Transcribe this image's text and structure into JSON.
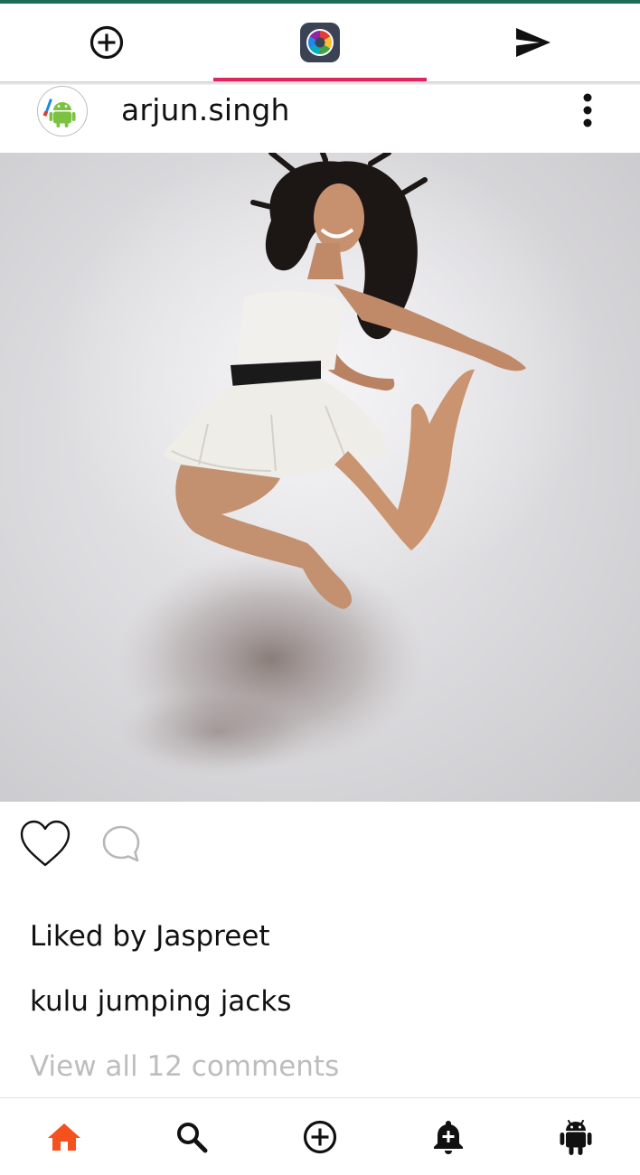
{
  "top_tabs": [
    {
      "icon": "add-circle-icon",
      "active": false
    },
    {
      "icon": "app-logo-icon",
      "active": true
    },
    {
      "icon": "send-icon",
      "active": false
    }
  ],
  "colors": {
    "status_stripe": "#1e6b5a",
    "active_tab_indicator": "#e0245e",
    "home_active": "#f4511e",
    "muted_text": "#bdbdbd"
  },
  "post": {
    "username": "arjun.singh",
    "liked_by_text": "Liked by Jaspreet",
    "caption": "kulu jumping jacks",
    "view_comments_text": "View all 12 comments"
  },
  "bottom_nav": [
    {
      "icon": "home-icon",
      "active": true
    },
    {
      "icon": "search-icon",
      "active": false
    },
    {
      "icon": "add-circle-icon",
      "active": false
    },
    {
      "icon": "notification-add-icon",
      "active": false
    },
    {
      "icon": "android-icon",
      "active": false
    }
  ]
}
